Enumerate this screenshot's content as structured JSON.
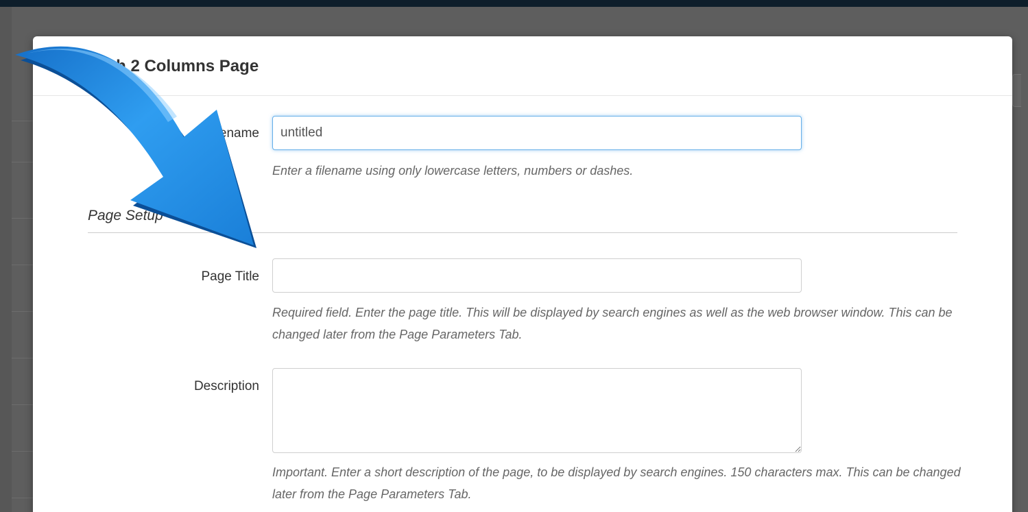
{
  "dialog": {
    "title": "New With 2 Columns Page"
  },
  "form": {
    "filename": {
      "label": "Filename",
      "value": "untitled",
      "help": "Enter a filename using only lowercase letters, numbers or dashes."
    },
    "section": {
      "title": "Page Setup"
    },
    "page_title": {
      "label": "Page Title",
      "value": "",
      "help": "Required field. Enter the page title. This will be displayed by search engines as well as the web browser window. This can be changed later from the Page Parameters Tab."
    },
    "description": {
      "label": "Description",
      "value": "",
      "help": "Important. Enter a short description of the page, to be displayed by search engines. 150 characters max. This can be changed later from the Page Parameters Tab."
    }
  },
  "annotation": {
    "icon": "curved-arrow-icon",
    "color": "#1f8fe6"
  },
  "colors": {
    "focus_border": "#66afe9",
    "backdrop": "#5e5e5e"
  }
}
